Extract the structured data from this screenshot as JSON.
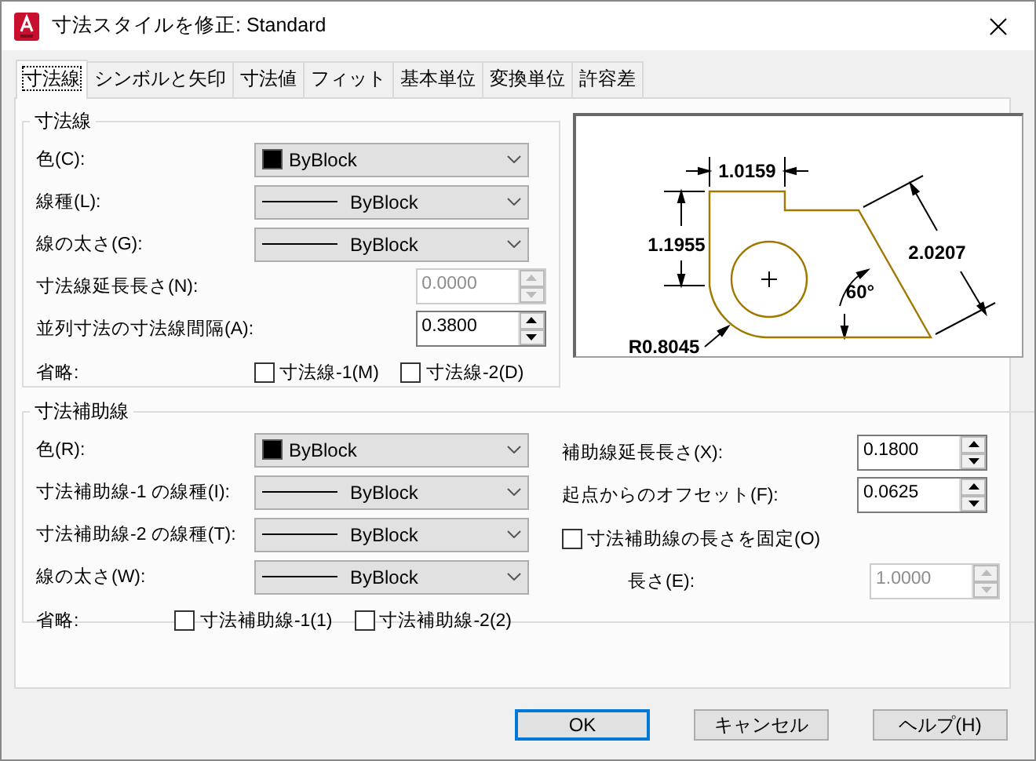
{
  "window": {
    "title": "寸法スタイルを修正: Standard"
  },
  "tabs": [
    {
      "label": "寸法線",
      "selected": true
    },
    {
      "label": "シンボルと矢印",
      "selected": false
    },
    {
      "label": "寸法値",
      "selected": false
    },
    {
      "label": "フィット",
      "selected": false
    },
    {
      "label": "基本単位",
      "selected": false
    },
    {
      "label": "変換単位",
      "selected": false
    },
    {
      "label": "許容差",
      "selected": false
    }
  ],
  "dimension_lines": {
    "title": "寸法線",
    "rows": [
      {
        "kind": "dropdown",
        "label": "色(C):",
        "value": "ByBlock",
        "swatch": true
      },
      {
        "kind": "dropdown",
        "label": "線種(L):",
        "value": "ByBlock",
        "swatch": false
      },
      {
        "kind": "dropdown",
        "label": "線の太さ(G):",
        "value": "ByBlock",
        "swatch": false
      },
      {
        "kind": "spinner",
        "label": "寸法線延長長さ(N):",
        "value": "0.0000",
        "disabled": true
      },
      {
        "kind": "spinner",
        "label": "並列寸法の寸法線間隔(A):",
        "value": "0.3800",
        "disabled": false
      }
    ],
    "suppress": {
      "label": "省略:",
      "options": [
        {
          "label": "寸法線-1(M)",
          "checked": false
        },
        {
          "label": "寸法線-2(D)",
          "checked": false
        }
      ]
    }
  },
  "preview": {
    "labels": [
      "1.0159",
      "1.1955",
      "2.0207",
      "60°",
      "R0.8045"
    ]
  },
  "extension_lines": {
    "title": "寸法補助線",
    "rows": [
      {
        "kind": "dropdown",
        "label": "色(R):",
        "value": "ByBlock",
        "swatch": true
      },
      {
        "kind": "dropdown",
        "label": "寸法補助線-1 の線種(I):",
        "value": "ByBlock",
        "swatch": false
      },
      {
        "kind": "dropdown",
        "label": "寸法補助線-2 の線種(T):",
        "value": "ByBlock",
        "swatch": false
      },
      {
        "kind": "dropdown",
        "label": "線の太さ(W):",
        "value": "ByBlock",
        "swatch": false
      }
    ],
    "suppress": {
      "label": "省略:",
      "options": [
        {
          "label": "寸法補助線-1(1)",
          "checked": false
        },
        {
          "label": "寸法補助線-2(2)",
          "checked": false
        }
      ]
    },
    "right_rows": [
      {
        "kind": "spinner",
        "label": "補助線延長長さ(X):",
        "value": "0.1800",
        "disabled": false
      },
      {
        "kind": "spinner",
        "label": "起点からのオフセット(F):",
        "value": "0.0625",
        "disabled": false
      },
      {
        "kind": "checkbox",
        "label": "寸法補助線の長さを固定(O)",
        "checked": false
      },
      {
        "kind": "spinner",
        "label": "長さ(E):",
        "value": "1.0000",
        "disabled": true,
        "indent": true
      }
    ]
  },
  "buttons": [
    {
      "label": "OK",
      "default": true
    },
    {
      "label": "キャンセル",
      "default": false
    },
    {
      "label": "ヘルプ(H)",
      "default": false
    }
  ]
}
